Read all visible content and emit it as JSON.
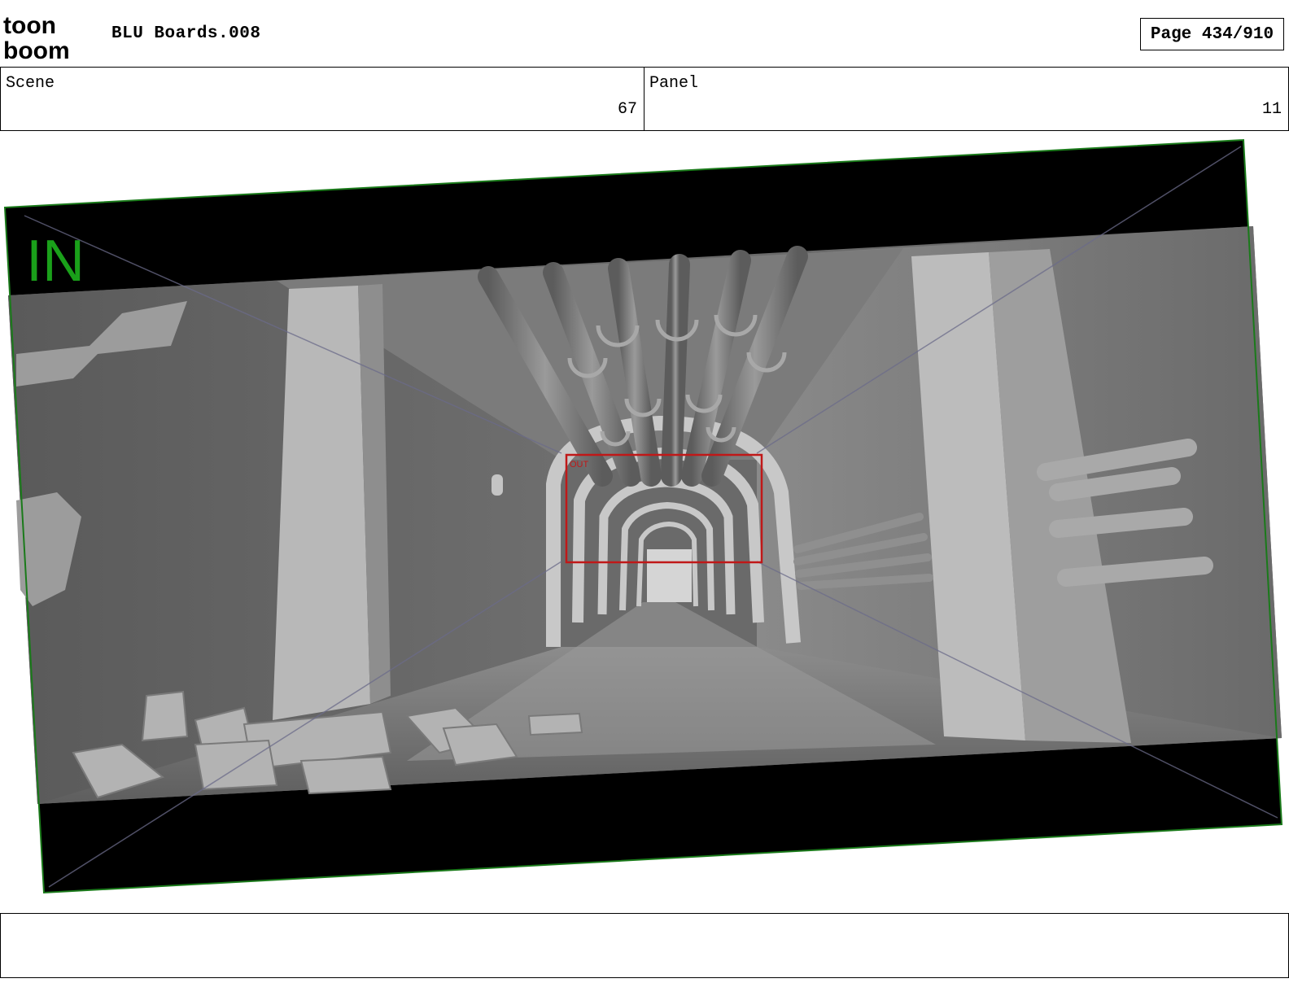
{
  "header": {
    "logo_text_top": "toon",
    "logo_text_bottom": "boom",
    "project_title": "BLU Boards.008",
    "page_label": "Page 434/910"
  },
  "info": {
    "scene_label": "Scene",
    "scene_value": "67",
    "panel_label": "Panel",
    "panel_value": "11"
  },
  "frame": {
    "camera_tag": "IN",
    "inner_frame_tag": "OUT",
    "colors": {
      "camera_frame": "#1aa01a",
      "field_guide": "#6b6bd8",
      "inner_frame": "#c01818",
      "letterbox": "#000000"
    }
  },
  "notes": {
    "text": ""
  }
}
